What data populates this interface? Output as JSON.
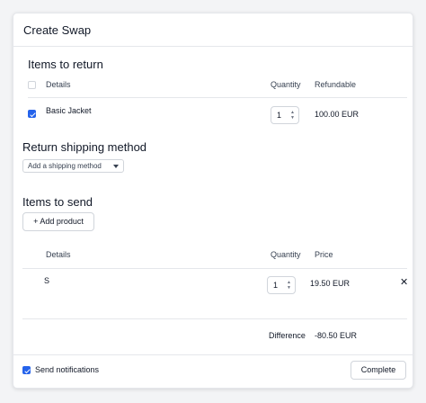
{
  "modal": {
    "title": "Create Swap"
  },
  "return_section": {
    "title": "Items to return",
    "headers": {
      "details": "Details",
      "quantity": "Quantity",
      "refundable": "Refundable"
    },
    "items": [
      {
        "name": "Basic Jacket",
        "quantity": "1",
        "refundable": "100.00 EUR",
        "checked": true
      }
    ]
  },
  "shipping_section": {
    "title": "Return shipping method",
    "dropdown_label": "Add a shipping method"
  },
  "send_section": {
    "title": "Items to send",
    "add_button": "+ Add product",
    "headers": {
      "details": "Details",
      "quantity": "Quantity",
      "price": "Price"
    },
    "items": [
      {
        "name": "S",
        "quantity": "1",
        "price": "19.50 EUR"
      }
    ],
    "difference_label": "Difference",
    "difference_value": "-80.50 EUR"
  },
  "footer": {
    "notifications_label": "Send notifications",
    "notifications_checked": true,
    "complete_button": "Complete"
  },
  "colors": {
    "accent": "#2563eb",
    "border": "#e5e7eb"
  },
  "icons": {
    "close": "close-icon",
    "stepper": "chevron-up-down-icon",
    "dropdown": "chevron-down-icon"
  }
}
